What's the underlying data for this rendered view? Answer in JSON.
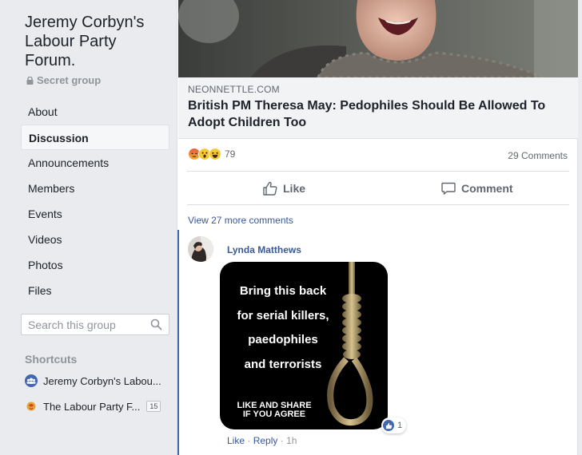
{
  "sidebar": {
    "group_title": "Jeremy Corbyn's Labour Party Forum.",
    "privacy": "Secret group",
    "nav": [
      "About",
      "Discussion",
      "Announcements",
      "Members",
      "Events",
      "Videos",
      "Photos",
      "Files"
    ],
    "active_nav": "Discussion",
    "search_placeholder": "Search this group",
    "shortcuts_title": "Shortcuts",
    "shortcuts": [
      {
        "label": "Jeremy Corbyn's Labou...",
        "icon": "group-icon"
      },
      {
        "label": "The Labour Party F...",
        "icon": "rose-icon",
        "badge": "15"
      }
    ]
  },
  "post": {
    "link_domain": "NEONNETTLE.COM",
    "link_title": "British PM Theresa May: Pedophiles Should Be Allowed To Adopt Children Too",
    "reaction_icons": [
      "angry-reaction-icon",
      "wow-reaction-icon",
      "haha-reaction-icon"
    ],
    "reaction_count": "79",
    "comment_count": "29 Comments",
    "like_label": "Like",
    "comment_label": "Comment",
    "view_more": "View 27 more comments"
  },
  "comment": {
    "author": "Lynda Matthews",
    "meme_lines": [
      "Bring this back",
      "for serial killers,",
      "paedophiles",
      "and terrorists"
    ],
    "meme_footer": [
      "LIKE AND SHARE",
      "IF YOU AGREE"
    ],
    "like_count": "1",
    "like_action": "Like",
    "reply_action": "Reply",
    "separator": "·",
    "time": "1h"
  },
  "colors": {
    "link": "#385898",
    "accent": "#4267b2",
    "muted": "#90949c",
    "background": "#e9ebee"
  }
}
